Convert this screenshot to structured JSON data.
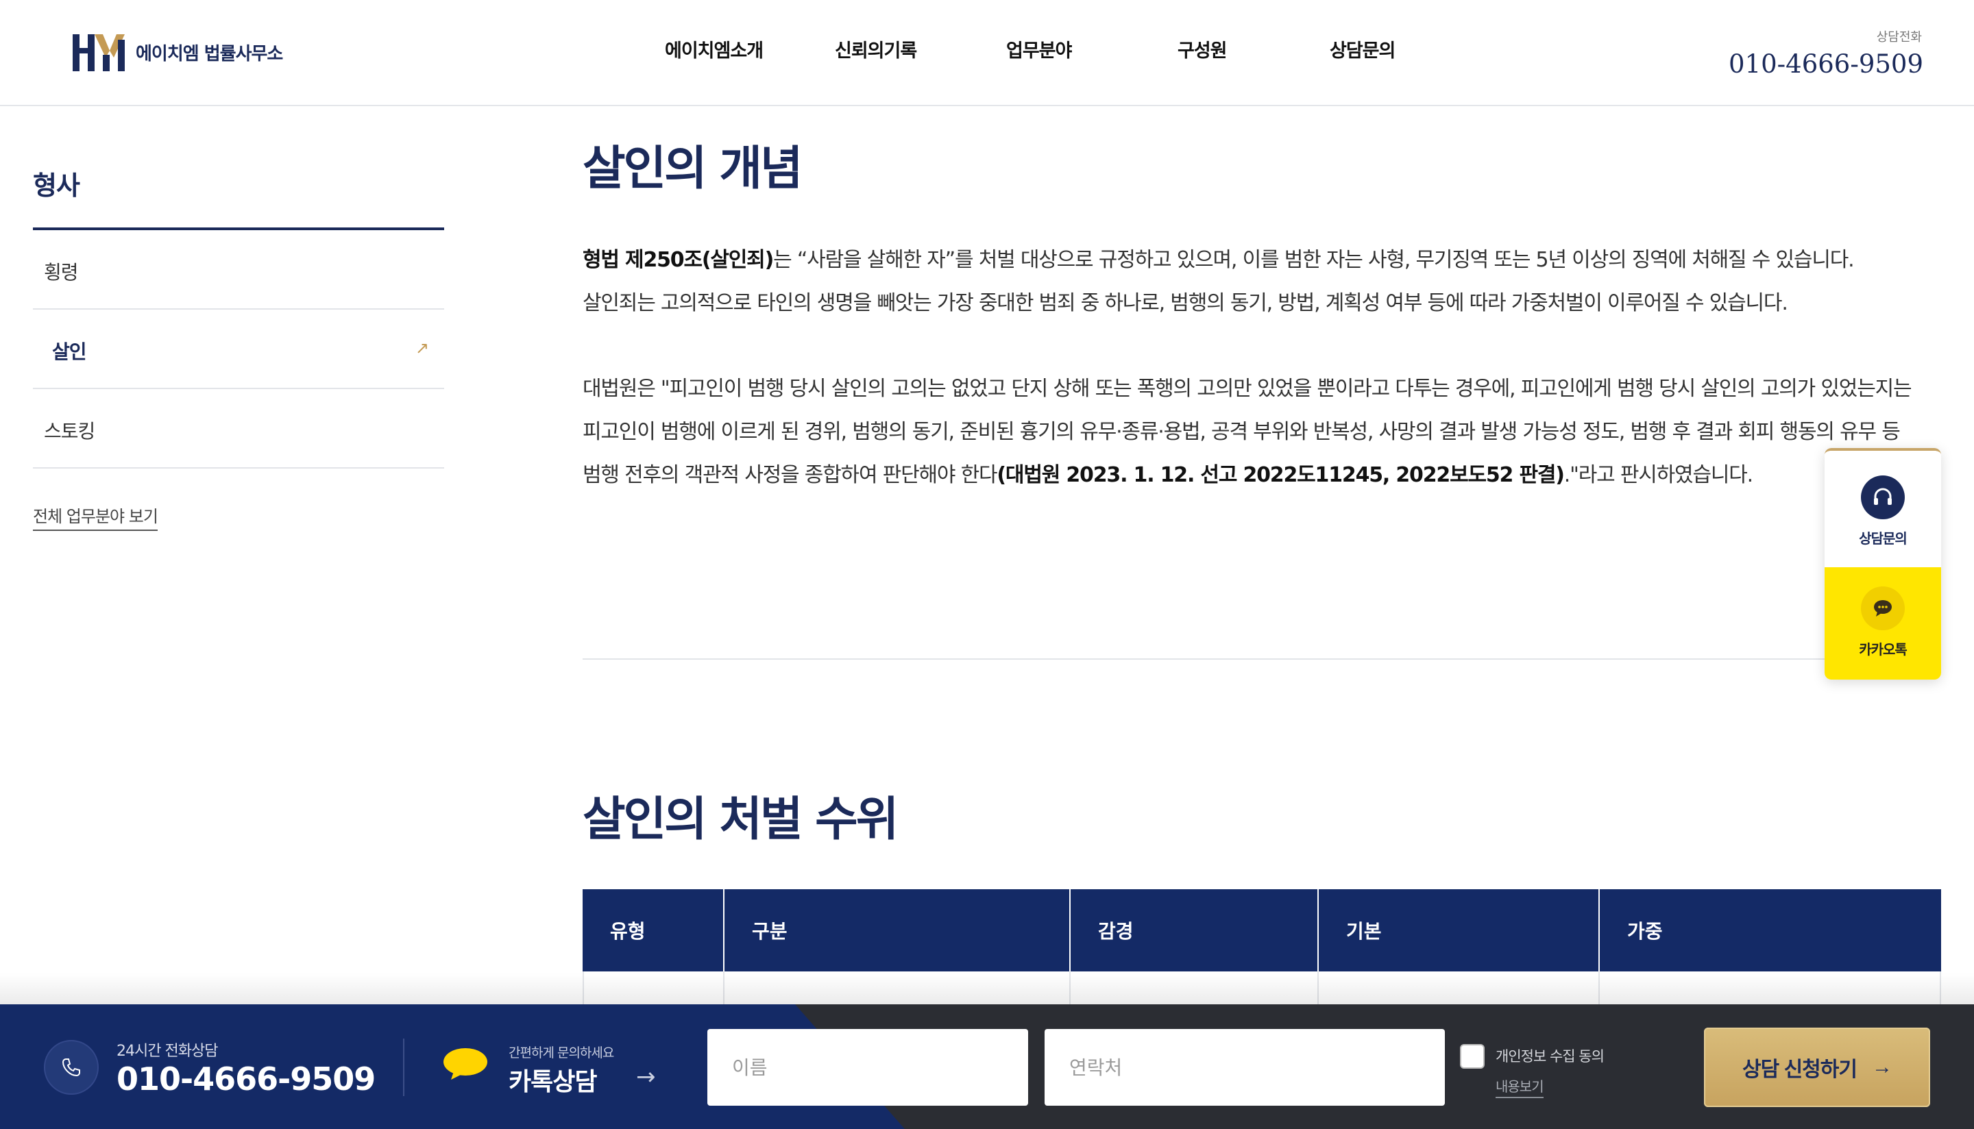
{
  "header": {
    "logo_text": "에이치엠 법률사무소",
    "nav": [
      "에이치엠소개",
      "신뢰의기록",
      "업무분야",
      "구성원",
      "상담문의"
    ],
    "phone_label": "상담전화",
    "phone": "010-4666-9509"
  },
  "sidebar": {
    "title": "형사",
    "items": [
      {
        "label": "횡령",
        "active": false
      },
      {
        "label": "살인",
        "active": true
      },
      {
        "label": "스토킹",
        "active": false
      }
    ],
    "view_all": "전체 업무분야 보기"
  },
  "section1": {
    "title": "살인의 개념",
    "p1_bold": "형법 제250조(살인죄)",
    "p1_rest": "는 “사람을 살해한 자”를 처벌 대상으로 규정하고 있으며, 이를 범한 자는 사형, 무기징역 또는 5년 이상의 징역에 처해질 수 있습니다.",
    "p1_line2": "살인죄는 고의적으로 타인의 생명을 빼앗는 가장 중대한 범죄 중 하나로, 범행의 동기, 방법, 계획성 여부 등에 따라 가중처벌이 이루어질 수 있습니다.",
    "p2_start": "대법원은 \"피고인이 범행 당시 살인의 고의는 없었고 단지 상해 또는 폭행의 고의만 있었을 뿐이라고 다투는 경우에, 피고인에게 범행 당시 살인의 고의가 있었는지는 피고인이 범행에 이르게 된 경위, 범행의 동기, 준비된 흉기의 유무·종류·용법, 공격 부위와 반복성, 사망의 결과 발생 가능성 정도, 범행 후 결과 회피 행동의 유무 등 범행 전후의 객관적 사정을 종합하여 판단해야 한다",
    "p2_bold": "(대법원 2023. 1. 12. 선고 2022도11245, 2022보도52 판결)",
    "p2_end": ".\"라고 판시하였습니다."
  },
  "section2": {
    "title": "살인의 처벌 수위",
    "table_headers": [
      "유형",
      "구분",
      "감경",
      "기본",
      "가중"
    ]
  },
  "float_widget": {
    "consult_label": "상담문의",
    "kakao_label": "카카오톡"
  },
  "bottom_bar": {
    "phone_sub": "24시간 전화상담",
    "phone": "010-4666-9509",
    "kakao_sub": "간편하게 문의하세요",
    "kakao_main": "카톡상담",
    "name_placeholder": "이름",
    "contact_placeholder": "연락처",
    "agree_label": "개인정보 수집 동의",
    "view_label": "내용보기",
    "submit_label": "상담 신청하기"
  }
}
